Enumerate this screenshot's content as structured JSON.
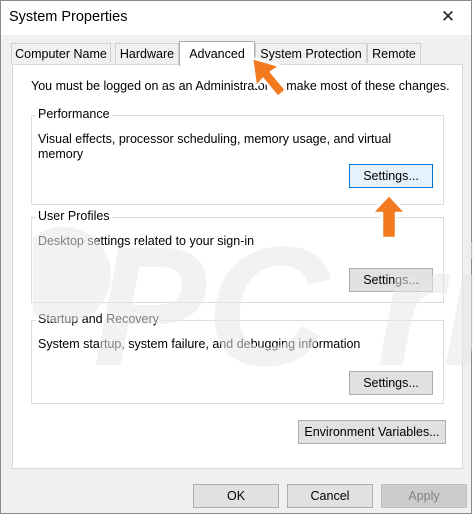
{
  "window": {
    "title": "System Properties"
  },
  "tabs": [
    {
      "label": "Computer Name",
      "active": false
    },
    {
      "label": "Hardware",
      "active": false
    },
    {
      "label": "Advanced",
      "active": true
    },
    {
      "label": "System Protection",
      "active": false
    },
    {
      "label": "Remote",
      "active": false
    }
  ],
  "intro_text": "You must be logged on as an Administrator to make most of these changes.",
  "groups": {
    "performance": {
      "label": "Performance",
      "description": "Visual effects, processor scheduling, memory usage, and virtual memory",
      "button": "Settings..."
    },
    "user_profiles": {
      "label": "User Profiles",
      "description": "Desktop settings related to your sign-in",
      "button": "Settings..."
    },
    "startup_recovery": {
      "label": "Startup and Recovery",
      "description": "System startup, system failure, and debugging information",
      "button": "Settings..."
    }
  },
  "environment_button": "Environment Variables...",
  "footer": {
    "ok": "OK",
    "cancel": "Cancel",
    "apply": "Apply"
  },
  "watermark_text": "PC risk.com",
  "colors": {
    "accent_arrow": "#f47a20",
    "focus_border": "#0078d7"
  }
}
